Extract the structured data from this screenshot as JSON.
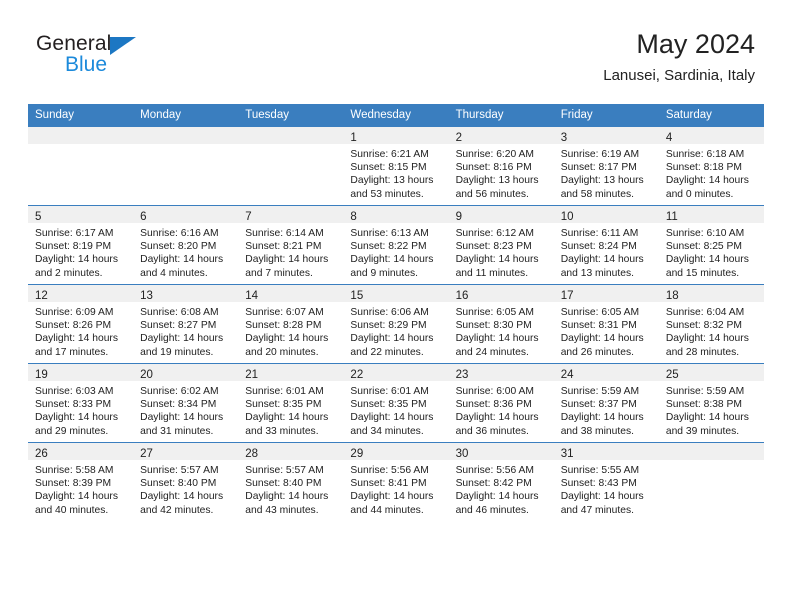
{
  "brand": {
    "name_dark": "General",
    "name_blue": "Blue",
    "accent_blue": "#1c8adb",
    "triangle_blue": "#1c77c3"
  },
  "header": {
    "title": "May 2024",
    "subtitle": "Lanusei, Sardinia, Italy"
  },
  "theme": {
    "header_row_bg": "#3a7ebf",
    "header_row_text": "#ffffff",
    "daynum_band_bg": "#f0f0f0",
    "cell_text": "#222222"
  },
  "weekdays": [
    "Sunday",
    "Monday",
    "Tuesday",
    "Wednesday",
    "Thursday",
    "Friday",
    "Saturday"
  ],
  "labels": {
    "sunrise_prefix": "Sunrise:",
    "sunset_prefix": "Sunset:",
    "daylight_prefix": "Daylight:"
  },
  "weeks": [
    [
      {
        "empty": true
      },
      {
        "empty": true
      },
      {
        "empty": true
      },
      {
        "day": "1",
        "sunrise": "Sunrise: 6:21 AM",
        "sunset": "Sunset: 8:15 PM",
        "daylight_1": "Daylight: 13 hours",
        "daylight_2": "and 53 minutes."
      },
      {
        "day": "2",
        "sunrise": "Sunrise: 6:20 AM",
        "sunset": "Sunset: 8:16 PM",
        "daylight_1": "Daylight: 13 hours",
        "daylight_2": "and 56 minutes."
      },
      {
        "day": "3",
        "sunrise": "Sunrise: 6:19 AM",
        "sunset": "Sunset: 8:17 PM",
        "daylight_1": "Daylight: 13 hours",
        "daylight_2": "and 58 minutes."
      },
      {
        "day": "4",
        "sunrise": "Sunrise: 6:18 AM",
        "sunset": "Sunset: 8:18 PM",
        "daylight_1": "Daylight: 14 hours",
        "daylight_2": "and 0 minutes."
      }
    ],
    [
      {
        "day": "5",
        "sunrise": "Sunrise: 6:17 AM",
        "sunset": "Sunset: 8:19 PM",
        "daylight_1": "Daylight: 14 hours",
        "daylight_2": "and 2 minutes."
      },
      {
        "day": "6",
        "sunrise": "Sunrise: 6:16 AM",
        "sunset": "Sunset: 8:20 PM",
        "daylight_1": "Daylight: 14 hours",
        "daylight_2": "and 4 minutes."
      },
      {
        "day": "7",
        "sunrise": "Sunrise: 6:14 AM",
        "sunset": "Sunset: 8:21 PM",
        "daylight_1": "Daylight: 14 hours",
        "daylight_2": "and 7 minutes."
      },
      {
        "day": "8",
        "sunrise": "Sunrise: 6:13 AM",
        "sunset": "Sunset: 8:22 PM",
        "daylight_1": "Daylight: 14 hours",
        "daylight_2": "and 9 minutes."
      },
      {
        "day": "9",
        "sunrise": "Sunrise: 6:12 AM",
        "sunset": "Sunset: 8:23 PM",
        "daylight_1": "Daylight: 14 hours",
        "daylight_2": "and 11 minutes."
      },
      {
        "day": "10",
        "sunrise": "Sunrise: 6:11 AM",
        "sunset": "Sunset: 8:24 PM",
        "daylight_1": "Daylight: 14 hours",
        "daylight_2": "and 13 minutes."
      },
      {
        "day": "11",
        "sunrise": "Sunrise: 6:10 AM",
        "sunset": "Sunset: 8:25 PM",
        "daylight_1": "Daylight: 14 hours",
        "daylight_2": "and 15 minutes."
      }
    ],
    [
      {
        "day": "12",
        "sunrise": "Sunrise: 6:09 AM",
        "sunset": "Sunset: 8:26 PM",
        "daylight_1": "Daylight: 14 hours",
        "daylight_2": "and 17 minutes."
      },
      {
        "day": "13",
        "sunrise": "Sunrise: 6:08 AM",
        "sunset": "Sunset: 8:27 PM",
        "daylight_1": "Daylight: 14 hours",
        "daylight_2": "and 19 minutes."
      },
      {
        "day": "14",
        "sunrise": "Sunrise: 6:07 AM",
        "sunset": "Sunset: 8:28 PM",
        "daylight_1": "Daylight: 14 hours",
        "daylight_2": "and 20 minutes."
      },
      {
        "day": "15",
        "sunrise": "Sunrise: 6:06 AM",
        "sunset": "Sunset: 8:29 PM",
        "daylight_1": "Daylight: 14 hours",
        "daylight_2": "and 22 minutes."
      },
      {
        "day": "16",
        "sunrise": "Sunrise: 6:05 AM",
        "sunset": "Sunset: 8:30 PM",
        "daylight_1": "Daylight: 14 hours",
        "daylight_2": "and 24 minutes."
      },
      {
        "day": "17",
        "sunrise": "Sunrise: 6:05 AM",
        "sunset": "Sunset: 8:31 PM",
        "daylight_1": "Daylight: 14 hours",
        "daylight_2": "and 26 minutes."
      },
      {
        "day": "18",
        "sunrise": "Sunrise: 6:04 AM",
        "sunset": "Sunset: 8:32 PM",
        "daylight_1": "Daylight: 14 hours",
        "daylight_2": "and 28 minutes."
      }
    ],
    [
      {
        "day": "19",
        "sunrise": "Sunrise: 6:03 AM",
        "sunset": "Sunset: 8:33 PM",
        "daylight_1": "Daylight: 14 hours",
        "daylight_2": "and 29 minutes."
      },
      {
        "day": "20",
        "sunrise": "Sunrise: 6:02 AM",
        "sunset": "Sunset: 8:34 PM",
        "daylight_1": "Daylight: 14 hours",
        "daylight_2": "and 31 minutes."
      },
      {
        "day": "21",
        "sunrise": "Sunrise: 6:01 AM",
        "sunset": "Sunset: 8:35 PM",
        "daylight_1": "Daylight: 14 hours",
        "daylight_2": "and 33 minutes."
      },
      {
        "day": "22",
        "sunrise": "Sunrise: 6:01 AM",
        "sunset": "Sunset: 8:35 PM",
        "daylight_1": "Daylight: 14 hours",
        "daylight_2": "and 34 minutes."
      },
      {
        "day": "23",
        "sunrise": "Sunrise: 6:00 AM",
        "sunset": "Sunset: 8:36 PM",
        "daylight_1": "Daylight: 14 hours",
        "daylight_2": "and 36 minutes."
      },
      {
        "day": "24",
        "sunrise": "Sunrise: 5:59 AM",
        "sunset": "Sunset: 8:37 PM",
        "daylight_1": "Daylight: 14 hours",
        "daylight_2": "and 38 minutes."
      },
      {
        "day": "25",
        "sunrise": "Sunrise: 5:59 AM",
        "sunset": "Sunset: 8:38 PM",
        "daylight_1": "Daylight: 14 hours",
        "daylight_2": "and 39 minutes."
      }
    ],
    [
      {
        "day": "26",
        "sunrise": "Sunrise: 5:58 AM",
        "sunset": "Sunset: 8:39 PM",
        "daylight_1": "Daylight: 14 hours",
        "daylight_2": "and 40 minutes."
      },
      {
        "day": "27",
        "sunrise": "Sunrise: 5:57 AM",
        "sunset": "Sunset: 8:40 PM",
        "daylight_1": "Daylight: 14 hours",
        "daylight_2": "and 42 minutes."
      },
      {
        "day": "28",
        "sunrise": "Sunrise: 5:57 AM",
        "sunset": "Sunset: 8:40 PM",
        "daylight_1": "Daylight: 14 hours",
        "daylight_2": "and 43 minutes."
      },
      {
        "day": "29",
        "sunrise": "Sunrise: 5:56 AM",
        "sunset": "Sunset: 8:41 PM",
        "daylight_1": "Daylight: 14 hours",
        "daylight_2": "and 44 minutes."
      },
      {
        "day": "30",
        "sunrise": "Sunrise: 5:56 AM",
        "sunset": "Sunset: 8:42 PM",
        "daylight_1": "Daylight: 14 hours",
        "daylight_2": "and 46 minutes."
      },
      {
        "day": "31",
        "sunrise": "Sunrise: 5:55 AM",
        "sunset": "Sunset: 8:43 PM",
        "daylight_1": "Daylight: 14 hours",
        "daylight_2": "and 47 minutes."
      },
      {
        "empty": true
      }
    ]
  ]
}
